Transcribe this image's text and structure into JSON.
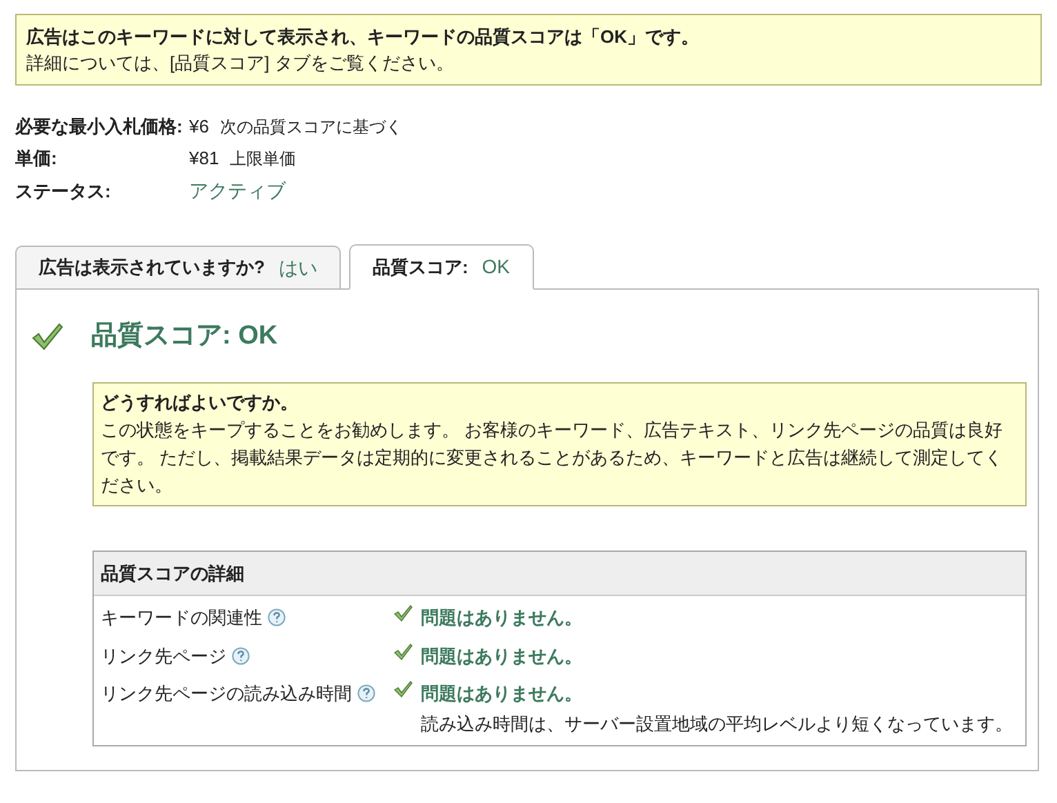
{
  "notice": {
    "title": "広告はこのキーワードに対して表示され、キーワードの品質スコアは「OK」です。",
    "body": "詳細については、[品質スコア] タブをご覧ください。"
  },
  "fields": [
    {
      "label": "必要な最小入札価格:",
      "value": "¥6",
      "note": "次の品質スコアに基づく",
      "kind": "plain"
    },
    {
      "label": "単価:",
      "value": "¥81",
      "note": "上限単価",
      "kind": "plain"
    },
    {
      "label": "ステータス:",
      "value": "アクティブ",
      "kind": "status"
    }
  ],
  "tabs": [
    {
      "label": "広告は表示されていますか?",
      "value": "はい",
      "selected": false
    },
    {
      "label": "品質スコア:",
      "value": "OK",
      "selected": true
    }
  ],
  "panel": {
    "title": "品質スコア: OK",
    "advice": {
      "title": "どうすればよいですか。",
      "body": "この状態をキープすることをお勧めします。 お客様のキーワード、広告テキスト、リンク先ページの品質は良好です。 ただし、掲載結果データは定期的に変更されることがあるため、キーワードと広告は継続して測定してください。"
    },
    "details": {
      "title": "品質スコアの詳細",
      "rows": [
        {
          "label": "キーワードの関連性",
          "ok": true,
          "result": "問題はありません。"
        },
        {
          "label": "リンク先ページ",
          "ok": true,
          "result": "問題はありません。"
        },
        {
          "label": "リンク先ページの読み込み時間",
          "ok": true,
          "result": "問題はありません。",
          "note": "読み込み時間は、サーバー設置地域の平均レベルより短くなっています。"
        }
      ]
    }
  }
}
